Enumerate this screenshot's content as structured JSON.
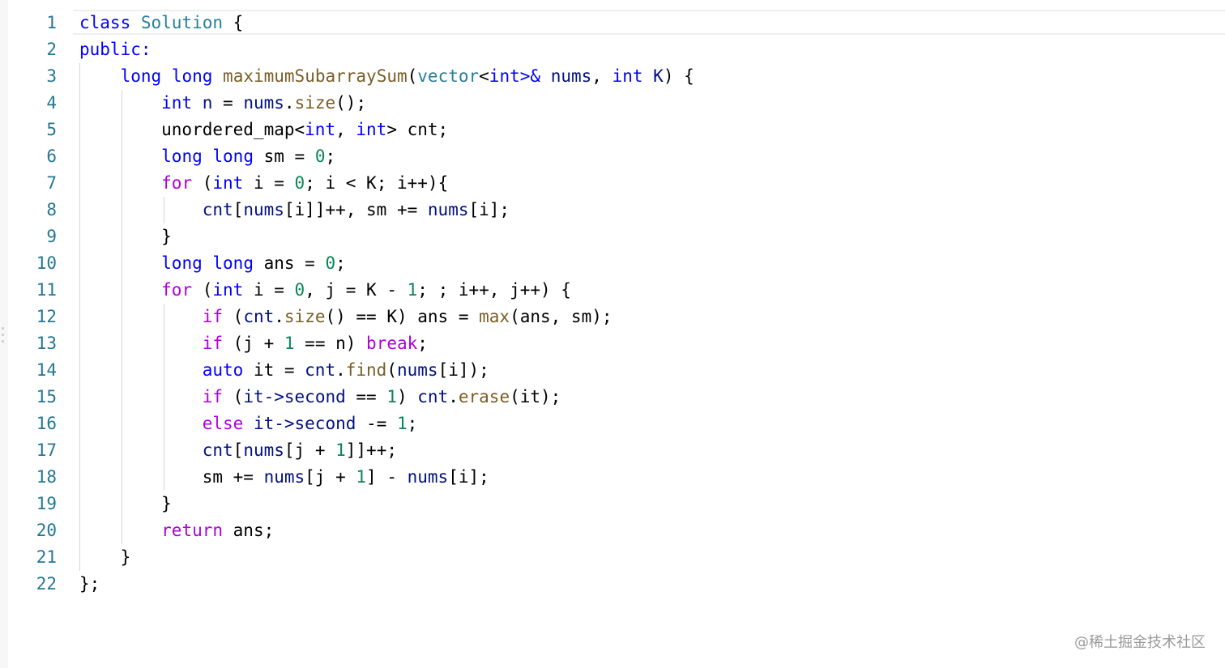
{
  "editor": {
    "line_numbers": [
      "1",
      "2",
      "3",
      "4",
      "5",
      "6",
      "7",
      "8",
      "9",
      "10",
      "11",
      "12",
      "13",
      "14",
      "15",
      "16",
      "17",
      "18",
      "19",
      "20",
      "21",
      "22"
    ],
    "lines": [
      [
        {
          "t": "class",
          "c": "kw"
        },
        {
          "t": " "
        },
        {
          "t": "Solution",
          "c": "ty"
        },
        {
          "t": " {"
        }
      ],
      [
        {
          "t": "public:",
          "c": "kw"
        }
      ],
      [
        {
          "t": "    "
        },
        {
          "t": "long",
          "c": "kw"
        },
        {
          "t": " "
        },
        {
          "t": "long",
          "c": "kw"
        },
        {
          "t": " "
        },
        {
          "t": "maximumSubarraySum",
          "c": "fn"
        },
        {
          "t": "("
        },
        {
          "t": "vector",
          "c": "ty"
        },
        {
          "t": "<"
        },
        {
          "t": "int",
          "c": "kw"
        },
        {
          "t": ">&",
          "c": "kw"
        },
        {
          "t": " "
        },
        {
          "t": "nums",
          "c": "va"
        },
        {
          "t": ", "
        },
        {
          "t": "int",
          "c": "kw"
        },
        {
          "t": " "
        },
        {
          "t": "K",
          "c": "va"
        },
        {
          "t": ") {"
        }
      ],
      [
        {
          "t": "        "
        },
        {
          "t": "int",
          "c": "kw"
        },
        {
          "t": " "
        },
        {
          "t": "n",
          "c": "va"
        },
        {
          "t": " = "
        },
        {
          "t": "nums",
          "c": "va"
        },
        {
          "t": "."
        },
        {
          "t": "size",
          "c": "fn"
        },
        {
          "t": "();"
        }
      ],
      [
        {
          "t": "        unordered_map<"
        },
        {
          "t": "int",
          "c": "kw"
        },
        {
          "t": ", "
        },
        {
          "t": "int",
          "c": "kw"
        },
        {
          "t": "> cnt;"
        }
      ],
      [
        {
          "t": "        "
        },
        {
          "t": "long",
          "c": "kw"
        },
        {
          "t": " "
        },
        {
          "t": "long",
          "c": "kw"
        },
        {
          "t": " sm = "
        },
        {
          "t": "0",
          "c": "nu"
        },
        {
          "t": ";"
        }
      ],
      [
        {
          "t": "        "
        },
        {
          "t": "for",
          "c": "ctl"
        },
        {
          "t": " ("
        },
        {
          "t": "int",
          "c": "kw"
        },
        {
          "t": " i = "
        },
        {
          "t": "0",
          "c": "nu"
        },
        {
          "t": "; i < K; i++){"
        }
      ],
      [
        {
          "t": "            "
        },
        {
          "t": "cnt",
          "c": "va"
        },
        {
          "t": "["
        },
        {
          "t": "nums",
          "c": "va"
        },
        {
          "t": "[i]]++, sm += "
        },
        {
          "t": "nums",
          "c": "va"
        },
        {
          "t": "[i];"
        }
      ],
      [
        {
          "t": "        }"
        }
      ],
      [
        {
          "t": "        "
        },
        {
          "t": "long",
          "c": "kw"
        },
        {
          "t": " "
        },
        {
          "t": "long",
          "c": "kw"
        },
        {
          "t": " ans = "
        },
        {
          "t": "0",
          "c": "nu"
        },
        {
          "t": ";"
        }
      ],
      [
        {
          "t": "        "
        },
        {
          "t": "for",
          "c": "ctl"
        },
        {
          "t": " ("
        },
        {
          "t": "int",
          "c": "kw"
        },
        {
          "t": " i = "
        },
        {
          "t": "0",
          "c": "nu"
        },
        {
          "t": ", j = K - "
        },
        {
          "t": "1",
          "c": "nu"
        },
        {
          "t": "; ; i++, j++) {"
        }
      ],
      [
        {
          "t": "            "
        },
        {
          "t": "if",
          "c": "ctl"
        },
        {
          "t": " ("
        },
        {
          "t": "cnt",
          "c": "va"
        },
        {
          "t": "."
        },
        {
          "t": "size",
          "c": "fn"
        },
        {
          "t": "() == K) ans = "
        },
        {
          "t": "max",
          "c": "fn"
        },
        {
          "t": "(ans, sm);"
        }
      ],
      [
        {
          "t": "            "
        },
        {
          "t": "if",
          "c": "ctl"
        },
        {
          "t": " (j + "
        },
        {
          "t": "1",
          "c": "nu"
        },
        {
          "t": " == n) "
        },
        {
          "t": "break",
          "c": "ctl"
        },
        {
          "t": ";"
        }
      ],
      [
        {
          "t": "            "
        },
        {
          "t": "auto",
          "c": "kw"
        },
        {
          "t": " it = "
        },
        {
          "t": "cnt",
          "c": "va"
        },
        {
          "t": "."
        },
        {
          "t": "find",
          "c": "fn"
        },
        {
          "t": "("
        },
        {
          "t": "nums",
          "c": "va"
        },
        {
          "t": "[i]);"
        }
      ],
      [
        {
          "t": "            "
        },
        {
          "t": "if",
          "c": "ctl"
        },
        {
          "t": " ("
        },
        {
          "t": "it->second",
          "c": "va"
        },
        {
          "t": " == "
        },
        {
          "t": "1",
          "c": "nu"
        },
        {
          "t": ") "
        },
        {
          "t": "cnt",
          "c": "va"
        },
        {
          "t": "."
        },
        {
          "t": "erase",
          "c": "fn"
        },
        {
          "t": "(it);"
        }
      ],
      [
        {
          "t": "            "
        },
        {
          "t": "else",
          "c": "ctl"
        },
        {
          "t": " "
        },
        {
          "t": "it->second",
          "c": "va"
        },
        {
          "t": " -= "
        },
        {
          "t": "1",
          "c": "nu"
        },
        {
          "t": ";"
        }
      ],
      [
        {
          "t": "            "
        },
        {
          "t": "cnt",
          "c": "va"
        },
        {
          "t": "["
        },
        {
          "t": "nums",
          "c": "va"
        },
        {
          "t": "[j + "
        },
        {
          "t": "1",
          "c": "nu"
        },
        {
          "t": "]]++;"
        }
      ],
      [
        {
          "t": "            sm += "
        },
        {
          "t": "nums",
          "c": "va"
        },
        {
          "t": "[j + "
        },
        {
          "t": "1",
          "c": "nu"
        },
        {
          "t": "] - "
        },
        {
          "t": "nums",
          "c": "va"
        },
        {
          "t": "[i];"
        }
      ],
      [
        {
          "t": "        }"
        }
      ],
      [
        {
          "t": "        "
        },
        {
          "t": "return",
          "c": "ctl"
        },
        {
          "t": " ans;"
        }
      ],
      [
        {
          "t": "    }"
        }
      ],
      [
        {
          "t": "};"
        }
      ]
    ]
  },
  "watermark": "@稀土掘金技术社区",
  "colors": {
    "keyword": "#0000ff",
    "control": "#af00db",
    "type": "#267f99",
    "function": "#795e26",
    "variable": "#001080",
    "number": "#098658",
    "line_number": "#237893"
  }
}
